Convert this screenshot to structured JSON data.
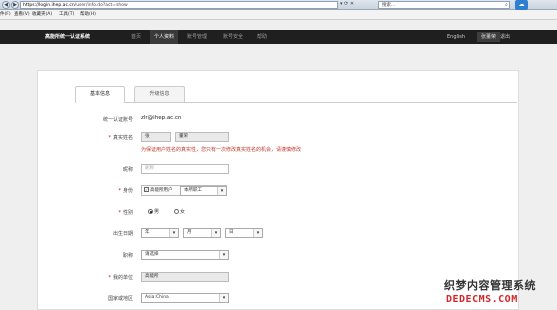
{
  "browser": {
    "back_glyph": "◀",
    "forward_glyph": "▶",
    "url_host": "https://login.ihep.ac.cn",
    "url_path": "/user/info.do?act=show",
    "url_tools": "▾ ⟳ ✕",
    "search_text": "搜索...",
    "search_glyph": "⌕",
    "cloud_glyph": "☁"
  },
  "menu": {
    "file": "件(F)",
    "view": "查看(V)",
    "favorites": "收藏夹(A)",
    "tools": "工具(T)",
    "help": "帮助(H)"
  },
  "site": {
    "title": "高能所统一认证系统",
    "nav": [
      "首页",
      "个人资料",
      "账号管理",
      "账号安全",
      "帮助"
    ],
    "language": "English",
    "user": "张董荣",
    "logout": "退出"
  },
  "tabs": [
    "基本信息",
    "升级信息"
  ],
  "form": {
    "account_label": "统一认证账号",
    "account_value": "zlr@ihep.ac.cn",
    "realname_label": "真实姓名",
    "surname": "张",
    "given_name": "董荣",
    "realname_hint": "为保证用户姓名的真实性，您只有一次修改真实姓名的机会，请谨慎修改",
    "nickname_label": "昵称",
    "nickname_placeholder": "昵称",
    "identity_label": "身份",
    "identity_checkbox": "高能所用户",
    "identity_select": "本所职工",
    "gender_label": "性别",
    "gender_male": "男",
    "gender_female": "女",
    "birth_label": "出生日期",
    "birth_year": "年",
    "birth_month": "月",
    "birth_day": "日",
    "title_label": "职称",
    "title_select": "请选择",
    "unit_label": "我的单位",
    "unit_value": "高能所",
    "country_label": "国家或地区",
    "country_select": "Asia:China",
    "required_mark": "*",
    "checkbox_mark": "✓",
    "dropdown_glyph": "▾"
  },
  "watermark": {
    "top": "织梦内容管理系统",
    "bottom": "DEDECMS.COM"
  }
}
